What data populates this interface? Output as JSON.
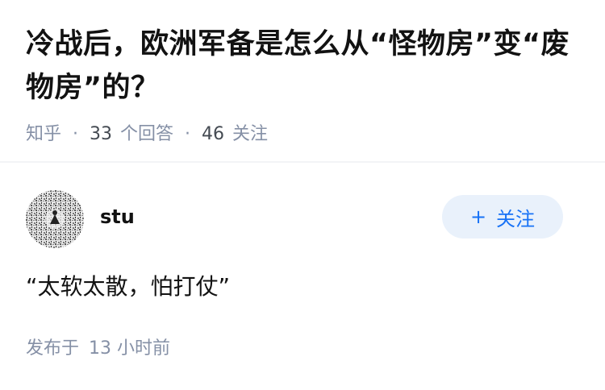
{
  "question": {
    "title": "冷战后，欧洲军备是怎么从“怪物房”变“废物房”的？",
    "source": "知乎",
    "answers_count": "33",
    "answers_label": "个回答",
    "followers_count": "46",
    "followers_label": "关注"
  },
  "answer": {
    "author_name": "stu",
    "follow_button": {
      "plus": "+",
      "label": "关注"
    },
    "text": "“太软太散，怕打仗”",
    "publish_label": "发布于",
    "publish_time": "13 小时前"
  },
  "icons": {
    "avatar": "user-avatar-image"
  },
  "colors": {
    "accent": "#1772f6",
    "button_bg": "#e9f1fb",
    "meta": "#8590a6",
    "text": "#121212"
  }
}
